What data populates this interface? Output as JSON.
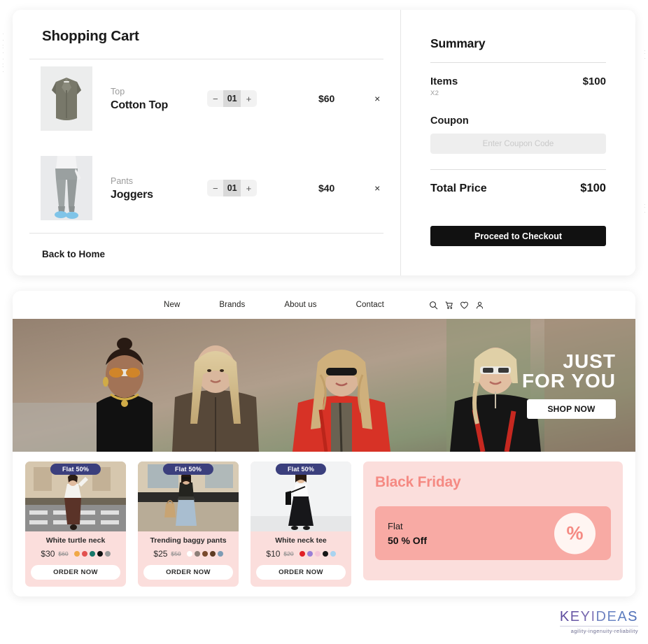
{
  "cart": {
    "title": "Shopping Cart",
    "back_link": "Back to Home",
    "items": [
      {
        "category": "Top",
        "name": "Cotton Top",
        "qty": "01",
        "price": "$60",
        "minus": "−",
        "plus": "+",
        "remove": "×"
      },
      {
        "category": "Pants",
        "name": "Joggers",
        "qty": "01",
        "price": "$40",
        "minus": "−",
        "plus": "+",
        "remove": "×"
      }
    ]
  },
  "summary": {
    "title": "Summary",
    "items_label": "Items",
    "items_value": "$100",
    "items_count": "X2",
    "coupon_label": "Coupon",
    "coupon_value": "",
    "coupon_placeholder": "Enter Coupon Code",
    "total_label": "Total Price",
    "total_value": "$100",
    "checkout_label": "Proceed to Checkout"
  },
  "store": {
    "nav": {
      "links": [
        "New",
        "Brands",
        "About us",
        "Contact"
      ],
      "icons": [
        "search-icon",
        "cart-icon",
        "heart-icon",
        "user-icon"
      ]
    },
    "hero": {
      "line1": "JUST",
      "line2": "FOR YOU",
      "cta": "SHOP NOW"
    },
    "products": [
      {
        "badge": "Flat 50%",
        "name": "White turtle neck",
        "price": "$30",
        "old_price": "$60",
        "cta": "ORDER NOW",
        "swatches": [
          "#f0a846",
          "#e2514f",
          "#16786a",
          "#111111",
          "#9b9b9b"
        ]
      },
      {
        "badge": "Flat 50%",
        "name": "Trending baggy pants",
        "price": "$25",
        "old_price": "$50",
        "cta": "ORDER NOW",
        "swatches": [
          "#ffffff",
          "#8d7f78",
          "#7a4a2d",
          "#5e3b22",
          "#7d9bb4"
        ]
      },
      {
        "badge": "Flat 50%",
        "name": "White neck tee",
        "price": "$10",
        "old_price": "$20",
        "cta": "ORDER NOW",
        "swatches": [
          "#e01f26",
          "#9a7fd6",
          "#f6c6d7",
          "#161616",
          "#a9d3f0"
        ]
      }
    ],
    "promo": {
      "title": "Black Friday",
      "flat": "Flat",
      "off": "50 % Off",
      "percent_symbol": "%"
    }
  },
  "logo": {
    "text": "KEYIDEAS",
    "tagline": "agility-ingenuity-reliability",
    "letters": [
      {
        "ch": "K",
        "color": "#5c4b9e"
      },
      {
        "ch": "E",
        "color": "#6a59a6"
      },
      {
        "ch": "Y",
        "color": "#7768af"
      },
      {
        "ch": "I",
        "color": "#8376b7"
      },
      {
        "ch": "D",
        "color": "#6f82c0"
      },
      {
        "ch": "E",
        "color": "#6b86c4"
      },
      {
        "ch": "A",
        "color": "#5f7fc0"
      },
      {
        "ch": "S",
        "color": "#4f6fb8"
      }
    ]
  },
  "colors": {
    "accent_dark": "#111111",
    "badge": "#3b3f7d",
    "card_pink": "#fbdedc",
    "promo_pink": "#f8aaa4",
    "promo_text": "#f58a83"
  }
}
